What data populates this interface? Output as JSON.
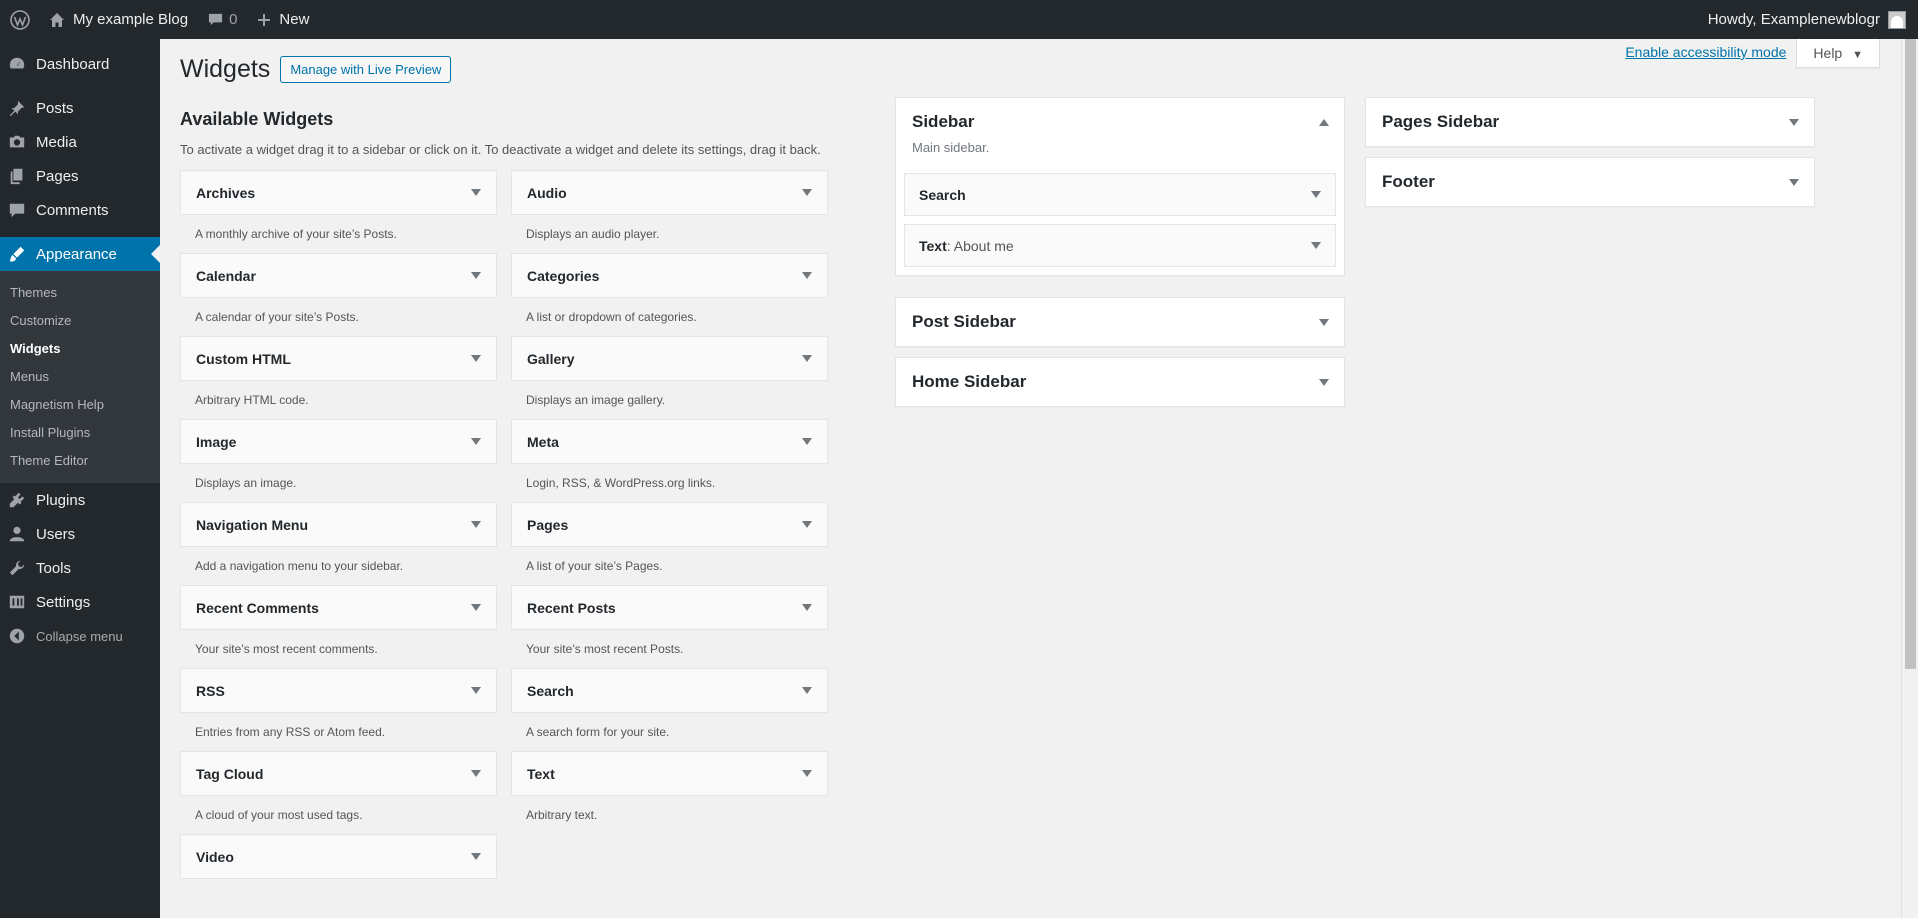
{
  "adminbar": {
    "site_name": "My example Blog",
    "comments_count": "0",
    "new_label": "New",
    "howdy": "Howdy, Examplenewblogr"
  },
  "sidebar": {
    "items": [
      {
        "label": "Dashboard"
      },
      {
        "label": "Posts"
      },
      {
        "label": "Media"
      },
      {
        "label": "Pages"
      },
      {
        "label": "Comments"
      },
      {
        "label": "Appearance"
      },
      {
        "label": "Plugins"
      },
      {
        "label": "Users"
      },
      {
        "label": "Tools"
      },
      {
        "label": "Settings"
      }
    ],
    "submenu": [
      "Themes",
      "Customize",
      "Widgets",
      "Menus",
      "Magnetism Help",
      "Install Plugins",
      "Theme Editor"
    ],
    "collapse": "Collapse menu"
  },
  "header": {
    "title": "Widgets",
    "live_preview": "Manage with Live Preview",
    "accessibility": "Enable accessibility mode",
    "help": "Help"
  },
  "available": {
    "title": "Available Widgets",
    "description": "To activate a widget drag it to a sidebar or click on it. To deactivate a widget and delete its settings, drag it back.",
    "widgets": [
      {
        "name": "Archives",
        "desc": "A monthly archive of your site’s Posts."
      },
      {
        "name": "Audio",
        "desc": "Displays an audio player."
      },
      {
        "name": "Calendar",
        "desc": "A calendar of your site’s Posts."
      },
      {
        "name": "Categories",
        "desc": "A list or dropdown of categories."
      },
      {
        "name": "Custom HTML",
        "desc": "Arbitrary HTML code."
      },
      {
        "name": "Gallery",
        "desc": "Displays an image gallery."
      },
      {
        "name": "Image",
        "desc": "Displays an image."
      },
      {
        "name": "Meta",
        "desc": "Login, RSS, & WordPress.org links."
      },
      {
        "name": "Navigation Menu",
        "desc": "Add a navigation menu to your sidebar."
      },
      {
        "name": "Pages",
        "desc": "A list of your site’s Pages."
      },
      {
        "name": "Recent Comments",
        "desc": "Your site’s most recent comments."
      },
      {
        "name": "Recent Posts",
        "desc": "Your site’s most recent Posts."
      },
      {
        "name": "RSS",
        "desc": "Entries from any RSS or Atom feed."
      },
      {
        "name": "Search",
        "desc": "A search form for your site."
      },
      {
        "name": "Tag Cloud",
        "desc": "A cloud of your most used tags."
      },
      {
        "name": "Text",
        "desc": "Arbitrary text."
      },
      {
        "name": "Video",
        "desc": ""
      }
    ]
  },
  "areas": {
    "sidebar": {
      "title": "Sidebar",
      "desc": "Main sidebar.",
      "widgets": [
        {
          "name": "Search",
          "sub": ""
        },
        {
          "name": "Text",
          "sub": ": About me"
        }
      ]
    },
    "post_sidebar": {
      "title": "Post Sidebar"
    },
    "home_sidebar": {
      "title": "Home Sidebar"
    },
    "pages_sidebar": {
      "title": "Pages Sidebar"
    },
    "footer": {
      "title": "Footer"
    }
  }
}
